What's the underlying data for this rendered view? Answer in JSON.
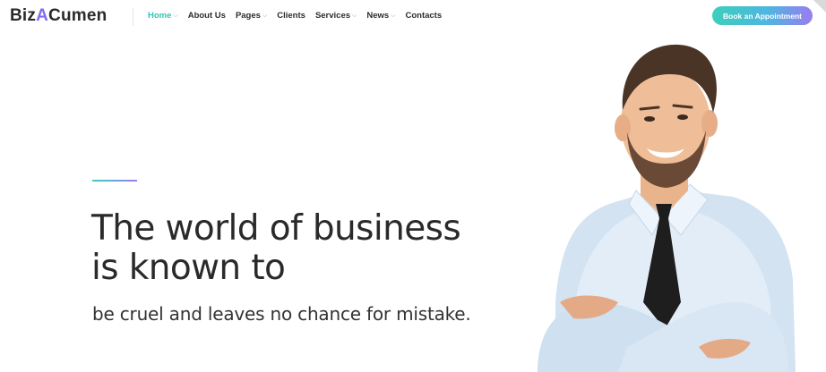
{
  "logo": {
    "part1": "Biz",
    "part2": "A",
    "part3": "Cumen"
  },
  "nav": {
    "items": [
      {
        "label": "Home",
        "active": true,
        "dropdown": true
      },
      {
        "label": "About Us",
        "active": false,
        "dropdown": false
      },
      {
        "label": "Pages",
        "active": false,
        "dropdown": true
      },
      {
        "label": "Clients",
        "active": false,
        "dropdown": false
      },
      {
        "label": "Services",
        "active": false,
        "dropdown": true
      },
      {
        "label": "News",
        "active": false,
        "dropdown": true
      },
      {
        "label": "Contacts",
        "active": false,
        "dropdown": false
      }
    ],
    "chevron": "⌵"
  },
  "cta": {
    "label": "Book an Appointment"
  },
  "hero": {
    "title_line1": "The world of business",
    "title_line2": "is known to",
    "subtitle": "be cruel and leaves no chance for mistake."
  },
  "colors": {
    "accent": "#33c6b6",
    "gradient_end": "#9a7cf0",
    "text": "#2a2a2a"
  },
  "icons": {
    "person_image": "businessman-illustration",
    "corner": "corner-fold-icon"
  }
}
